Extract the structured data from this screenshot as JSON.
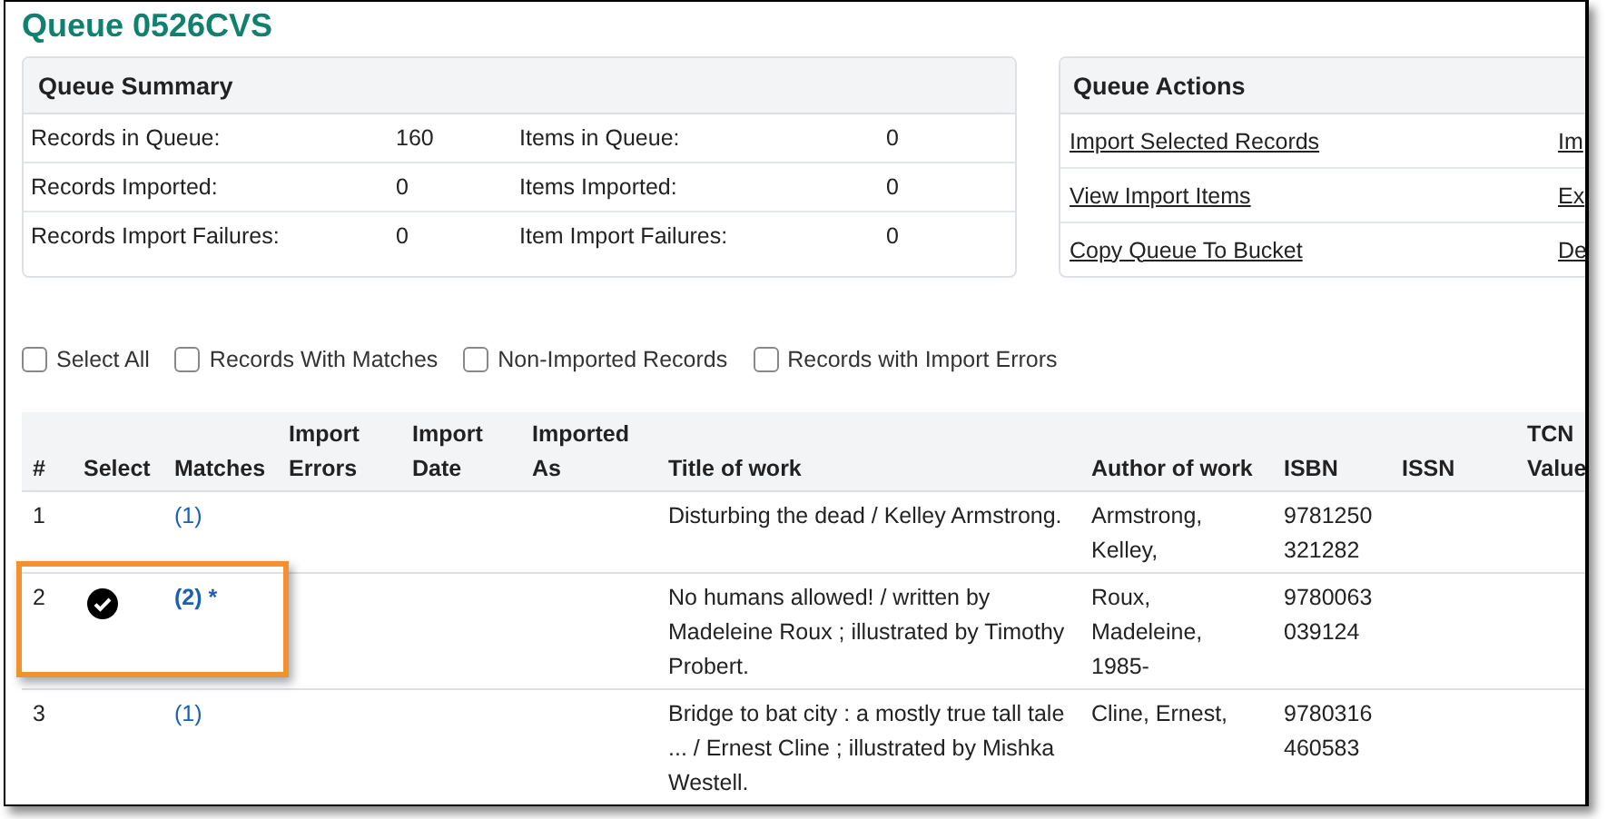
{
  "title": "Queue 0526CVS",
  "summary": {
    "title": "Queue Summary",
    "rows": [
      {
        "label": "Records in Queue:",
        "value": "160",
        "label_2": "Items in Queue:",
        "value_2": "0"
      },
      {
        "label": "Records Imported:",
        "value": "0",
        "label_2": "Items Imported:",
        "value_2": "0"
      },
      {
        "label": "Records Import Failures:",
        "value": "0",
        "label_2": "Item Import Failures:",
        "value_2": "0"
      }
    ]
  },
  "actions": {
    "title": "Queue Actions",
    "rows": [
      {
        "link": "Import Selected Records",
        "link_2": "Im"
      },
      {
        "link": "View Import Items",
        "link_2": "Ex"
      },
      {
        "link": "Copy Queue To Bucket",
        "link_2": "De"
      }
    ]
  },
  "filters": [
    {
      "label": "Select All",
      "checked": false
    },
    {
      "label": "Records With Matches",
      "checked": false
    },
    {
      "label": "Non-Imported Records",
      "checked": false
    },
    {
      "label": "Records with Import Errors",
      "checked": false
    }
  ],
  "table": {
    "columns": [
      "#",
      "Select",
      "Matches",
      "Import Errors",
      "Import Date",
      "Imported As",
      "Title of work",
      "Author of work",
      "ISBN",
      "ISSN",
      "TCN Value"
    ],
    "rows": [
      {
        "number": "1",
        "selected": false,
        "matches": "(1)",
        "title": "Disturbing the dead / Kelley Armstrong.",
        "author": "Armstrong, Kelley,",
        "isbn": "9781250321282",
        "highlighted": false
      },
      {
        "number": "2",
        "selected": true,
        "matches": "(2) *",
        "title": "No humans allowed! / written by Madeleine Roux ; illustrated by Timothy Probert.",
        "author": "Roux, Madeleine, 1985-",
        "isbn": "9780063039124",
        "highlighted": true
      },
      {
        "number": "3",
        "selected": false,
        "matches": "(1)",
        "title": "Bridge to bat city : a mostly true tall tale ... / Ernest Cline ; illustrated by Mishka Westell.",
        "author": "Cline, Ernest,",
        "isbn": "9780316460583",
        "highlighted": false
      }
    ]
  }
}
